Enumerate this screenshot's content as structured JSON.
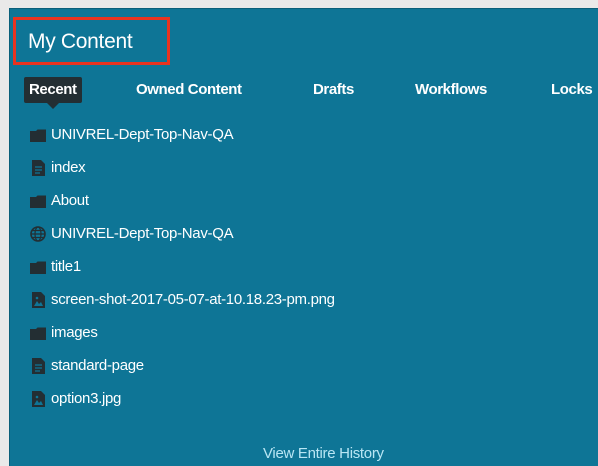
{
  "header": {
    "title": "My Content"
  },
  "tabs": [
    {
      "label": "Recent",
      "active": true
    },
    {
      "label": "Owned Content"
    },
    {
      "label": "Drafts"
    },
    {
      "label": "Workflows"
    },
    {
      "label": "Locks"
    }
  ],
  "items": [
    {
      "label": "UNIVREL-Dept-Top-Nav-QA",
      "icon": "folder-icon"
    },
    {
      "label": "index",
      "icon": "page-icon"
    },
    {
      "label": "About",
      "icon": "folder-icon"
    },
    {
      "label": "UNIVREL-Dept-Top-Nav-QA",
      "icon": "globe-icon"
    },
    {
      "label": "title1",
      "icon": "folder-icon"
    },
    {
      "label": "screen-shot-2017-05-07-at-10.18.23-pm.png",
      "icon": "image-file-icon"
    },
    {
      "label": "images",
      "icon": "folder-icon"
    },
    {
      "label": "standard-page",
      "icon": "page-icon"
    },
    {
      "label": "option3.jpg",
      "icon": "image-file-icon"
    }
  ],
  "footer": {
    "link_label": "View Entire History"
  },
  "colors": {
    "panel_bg": "#0e7596",
    "active_tab_bg": "#232e33",
    "highlight_border": "#e8331f",
    "icon_color": "#232e33",
    "link_color": "#b9e6f4"
  }
}
